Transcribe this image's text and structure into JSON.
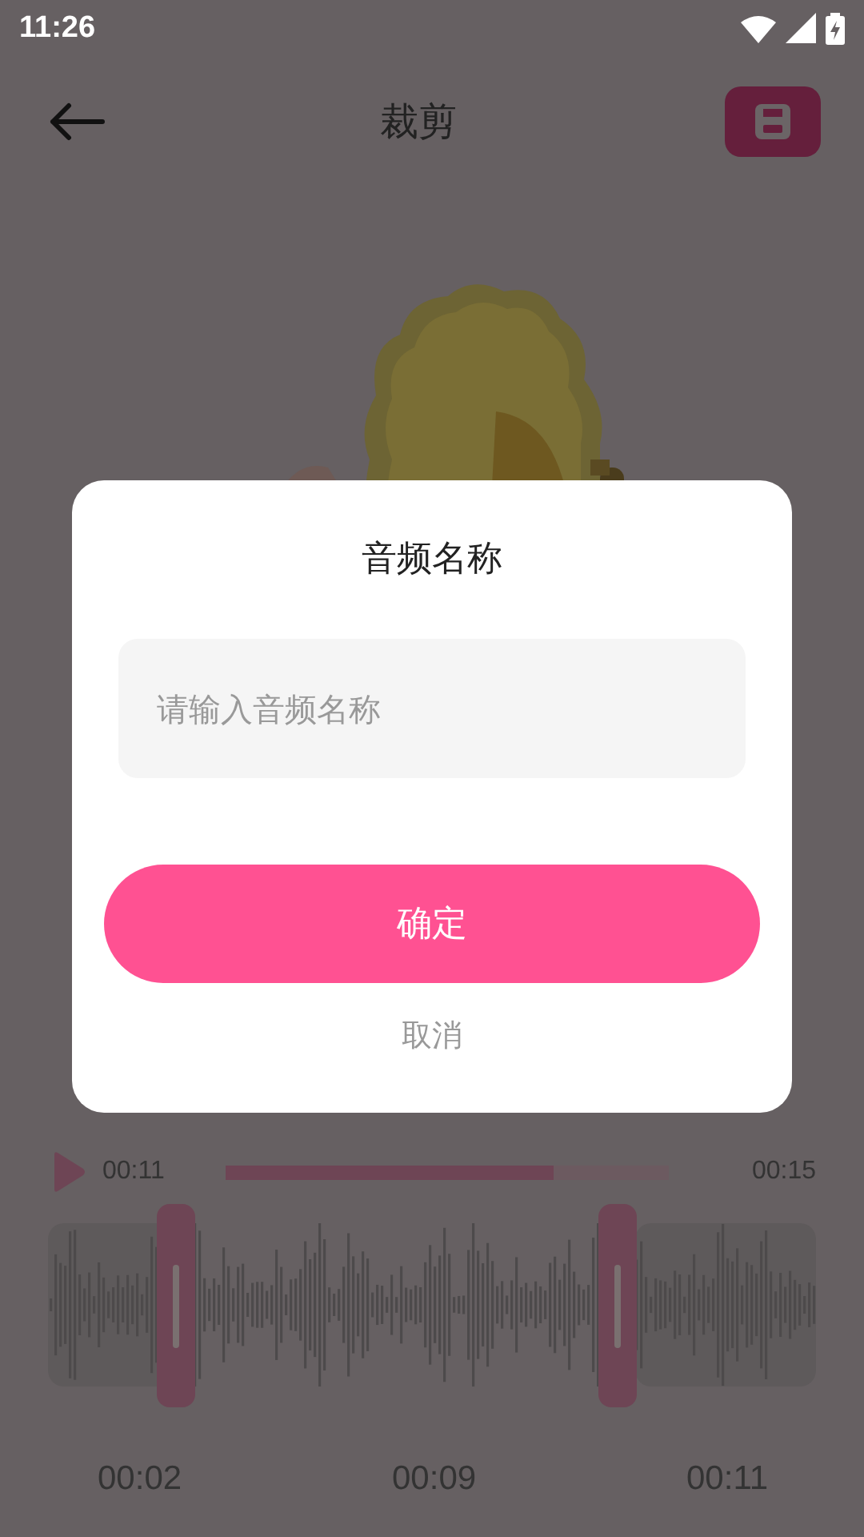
{
  "status_bar": {
    "time": "11:26"
  },
  "toolbar": {
    "title": "裁剪"
  },
  "player": {
    "current_time": "00:11",
    "total_time": "00:15",
    "level": 0.74
  },
  "trim_times": [
    "00:02",
    "00:09",
    "00:11"
  ],
  "dialog": {
    "title": "音频名称",
    "input": {
      "placeholder": "请输入音频名称"
    },
    "confirm": "确定",
    "cancel": "取消"
  }
}
